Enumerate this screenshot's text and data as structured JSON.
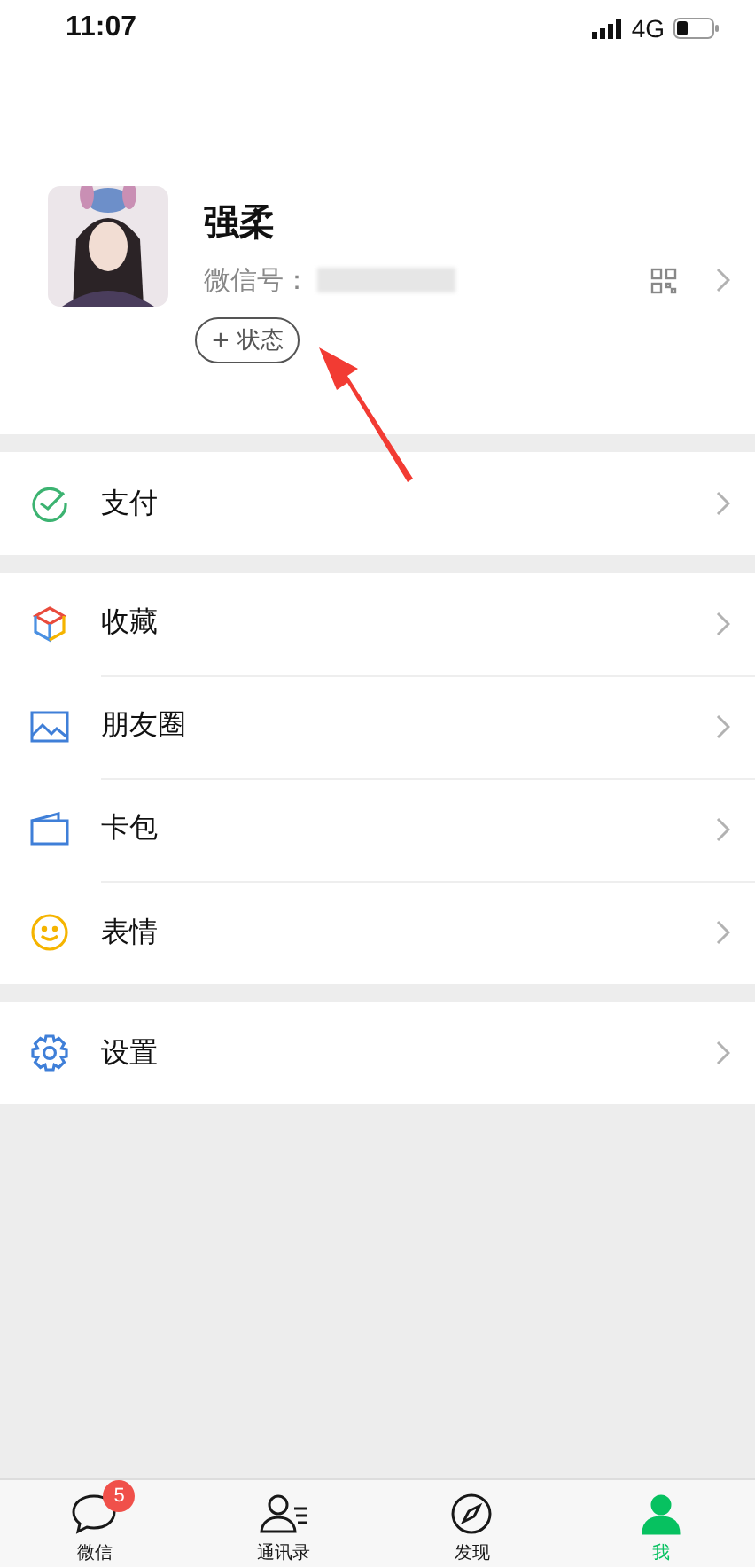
{
  "status_bar": {
    "time": "11:07",
    "network": "4G"
  },
  "profile": {
    "name": "强柔",
    "wechat_id_label": "微信号：",
    "status_button": "+ 状态"
  },
  "menu_sections": [
    [
      {
        "kind": "pay",
        "label": "支付"
      }
    ],
    [
      {
        "kind": "favorites",
        "label": "收藏"
      },
      {
        "kind": "moments",
        "label": "朋友圈"
      },
      {
        "kind": "cards",
        "label": "卡包"
      },
      {
        "kind": "stickers",
        "label": "表情"
      }
    ],
    [
      {
        "kind": "settings",
        "label": "设置"
      }
    ]
  ],
  "tab_bar": [
    {
      "kind": "chats",
      "label": "微信",
      "badge": "5",
      "selected": false
    },
    {
      "kind": "contacts",
      "label": "通讯录",
      "selected": false
    },
    {
      "kind": "discover",
      "label": "发现",
      "selected": false
    },
    {
      "kind": "me",
      "label": "我",
      "selected": true
    }
  ]
}
